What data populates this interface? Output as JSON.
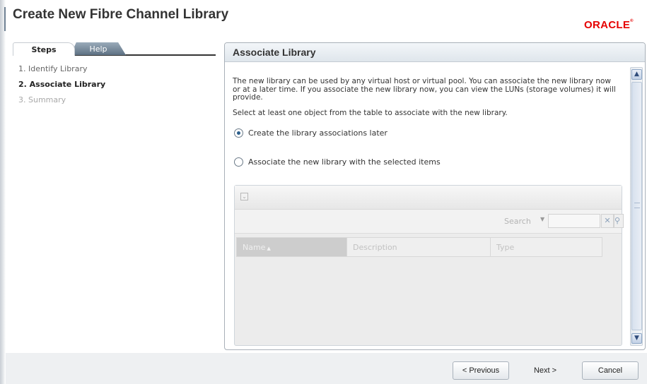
{
  "header": {
    "title": "Create New Fibre Channel Library",
    "brand": "ORACLE",
    "brand_color": "#e60000"
  },
  "nav": {
    "tabs": [
      "Steps",
      "Help"
    ],
    "steps": [
      {
        "label": "1. Identify Library",
        "state": "done"
      },
      {
        "label": "2. Associate Library",
        "state": "current"
      },
      {
        "label": "3. Summary",
        "state": "pending"
      }
    ]
  },
  "panel": {
    "title": "Associate Library",
    "description": "The new library can be used by any virtual host or virtual pool. You can associate the new library now or at a later time. If you associate the new library now, you can view the LUNs (storage volumes) it will provide.",
    "instruction": "Select at least one object from the table to associate with the new library.",
    "options": [
      {
        "label": "Create the library associations later",
        "checked": true
      },
      {
        "label": "Associate the new library with the selected items",
        "checked": false
      }
    ],
    "table": {
      "search_label": "Search",
      "search_value": "",
      "columns": [
        "Name",
        "Description",
        "Type"
      ],
      "sorted_column": "Name",
      "sort_direction": "ascending"
    }
  },
  "footer": {
    "previous_label": "< Previous",
    "next_label": "Next >",
    "cancel_label": "Cancel"
  },
  "icons": {
    "collapse": "collapse-icon",
    "sort": "sort-ascending-icon",
    "clear": "clear-icon",
    "search": "search-icon",
    "scroll_up": "chevron-up-icon",
    "scroll_down": "chevron-down-icon"
  }
}
